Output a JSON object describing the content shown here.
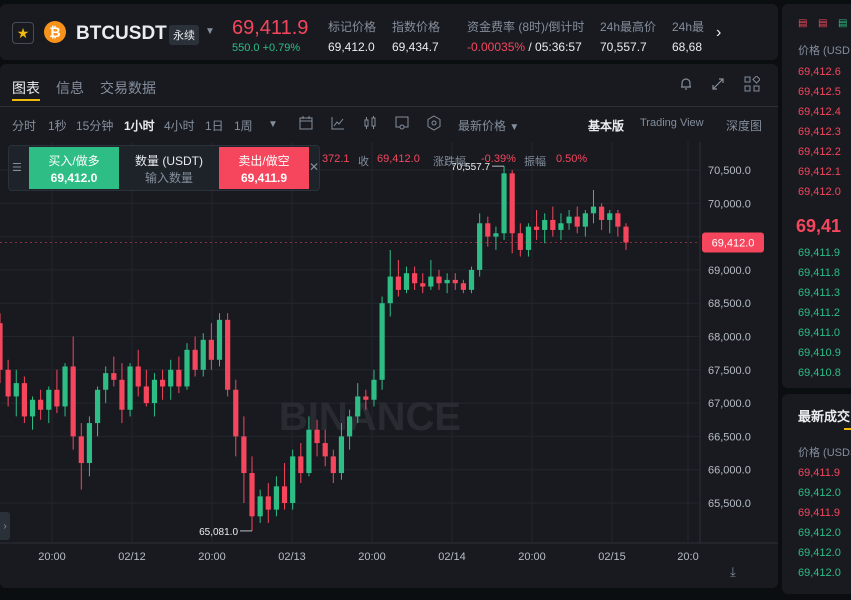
{
  "ticker": {
    "symbol": "BTCUSDT",
    "contract_type": "永续",
    "last_price": "69,411.9",
    "change": "550.0 +0.79%",
    "stats": [
      {
        "label": "标记价格",
        "value": "69,412.0"
      },
      {
        "label": "指数价格",
        "value": "69,434.7"
      },
      {
        "label": "资金费率 (8时)/倒计时",
        "value_rate": "-0.00035%",
        "value_countdown": "/ 05:36:57"
      },
      {
        "label": "24h最高价",
        "value": "70,557.7"
      },
      {
        "label": "24h最",
        "value": "68,68"
      }
    ]
  },
  "tabs": [
    "图表",
    "信息",
    "交易数据"
  ],
  "intervals": [
    "分时",
    "1秒",
    "15分钟",
    "1小时",
    "4小时",
    "1日",
    "1周"
  ],
  "active_interval": "1小时",
  "price_type": "最新价格",
  "views": [
    "基本版",
    "Trading View",
    "深度图"
  ],
  "order_widget": {
    "buy_label": "买入/做多",
    "buy_price": "69,412.0",
    "qty_label": "数量 (USDT)",
    "qty_placeholder": "输入数量",
    "sell_label": "卖出/做空",
    "sell_price": "69,411.9"
  },
  "ohlc": {
    "partial": "372.1",
    "close_label": "收",
    "close": "69,412.0",
    "change_label": "涨跌幅",
    "change": "-0.39%",
    "amp_label": "振幅",
    "amp": "0.50%"
  },
  "chart_data": {
    "type": "candlestick",
    "watermark": "BINANCE",
    "y_ticks": [
      65500,
      66000,
      66500,
      67000,
      67500,
      68000,
      68500,
      69000,
      69500,
      70000,
      70500
    ],
    "x_labels": [
      "20:00",
      "02/12",
      "20:00",
      "02/13",
      "20:00",
      "02/14",
      "20:00",
      "02/15",
      "20:0"
    ],
    "current_price": "69,412.0",
    "high_marker": "70,557.7",
    "low_marker": "65,081.0",
    "candles": [
      [
        68200,
        68350,
        67300,
        67500
      ],
      [
        67500,
        67650,
        66950,
        67100
      ],
      [
        67100,
        67500,
        66800,
        67300
      ],
      [
        67300,
        67400,
        66700,
        66800
      ],
      [
        66800,
        67100,
        66600,
        67050
      ],
      [
        67050,
        67200,
        66750,
        66900
      ],
      [
        66900,
        67250,
        66700,
        67200
      ],
      [
        67200,
        67500,
        66850,
        66950
      ],
      [
        66950,
        67600,
        66800,
        67550
      ],
      [
        67550,
        68000,
        66300,
        66500
      ],
      [
        66500,
        66700,
        65700,
        66100
      ],
      [
        66100,
        66800,
        65900,
        66700
      ],
      [
        66700,
        67250,
        66500,
        67200
      ],
      [
        67200,
        67550,
        67000,
        67450
      ],
      [
        67450,
        67700,
        67250,
        67350
      ],
      [
        67350,
        67600,
        66700,
        66900
      ],
      [
        66900,
        67600,
        66800,
        67550
      ],
      [
        67550,
        67800,
        67100,
        67250
      ],
      [
        67250,
        67500,
        66950,
        67000
      ],
      [
        67000,
        67450,
        66800,
        67350
      ],
      [
        67350,
        67500,
        67050,
        67250
      ],
      [
        67250,
        67650,
        67050,
        67500
      ],
      [
        67500,
        67700,
        67150,
        67250
      ],
      [
        67250,
        67900,
        67200,
        67800
      ],
      [
        67800,
        68000,
        67400,
        67500
      ],
      [
        67500,
        68050,
        67400,
        67950
      ],
      [
        67950,
        68200,
        67500,
        67650
      ],
      [
        67650,
        68350,
        67550,
        68250
      ],
      [
        68250,
        68350,
        67100,
        67200
      ],
      [
        67200,
        67350,
        66200,
        66500
      ],
      [
        66500,
        66800,
        65500,
        65950
      ],
      [
        65950,
        66200,
        65081,
        65300
      ],
      [
        65300,
        65700,
        65200,
        65600
      ],
      [
        65600,
        65800,
        65200,
        65400
      ],
      [
        65400,
        65900,
        65300,
        65750
      ],
      [
        65750,
        66100,
        65400,
        65500
      ],
      [
        65500,
        66300,
        65400,
        66200
      ],
      [
        66200,
        66400,
        65800,
        65950
      ],
      [
        65950,
        66800,
        65900,
        66600
      ],
      [
        66600,
        66750,
        66200,
        66400
      ],
      [
        66400,
        66600,
        66050,
        66200
      ],
      [
        66200,
        66300,
        65800,
        65950
      ],
      [
        65950,
        66700,
        65850,
        66500
      ],
      [
        66500,
        66900,
        66300,
        66800
      ],
      [
        66800,
        67300,
        66700,
        67100
      ],
      [
        67100,
        67200,
        66900,
        67050
      ],
      [
        67050,
        67500,
        66950,
        67350
      ],
      [
        67350,
        68600,
        67200,
        68500
      ],
      [
        68500,
        69300,
        68300,
        68900
      ],
      [
        68900,
        69150,
        68600,
        68700
      ],
      [
        68700,
        69050,
        68650,
        68950
      ],
      [
        68950,
        69050,
        68700,
        68800
      ],
      [
        68800,
        68950,
        68650,
        68750
      ],
      [
        68750,
        69150,
        68700,
        68900
      ],
      [
        68900,
        69000,
        68700,
        68800
      ],
      [
        68800,
        68950,
        68650,
        68850
      ],
      [
        68850,
        68950,
        68700,
        68800
      ],
      [
        68800,
        68850,
        68650,
        68700
      ],
      [
        68700,
        69050,
        68650,
        69000
      ],
      [
        69000,
        69850,
        68900,
        69700
      ],
      [
        69700,
        69800,
        69350,
        69500
      ],
      [
        69500,
        69650,
        69300,
        69550
      ],
      [
        69550,
        70557.7,
        69450,
        70450
      ],
      [
        70450,
        70500,
        69250,
        69550
      ],
      [
        69550,
        69700,
        69200,
        69300
      ],
      [
        69300,
        69700,
        69200,
        69650
      ],
      [
        69650,
        69900,
        69450,
        69600
      ],
      [
        69600,
        69850,
        69400,
        69750
      ],
      [
        69750,
        69950,
        69500,
        69600
      ],
      [
        69600,
        69850,
        69450,
        69700
      ],
      [
        69700,
        69900,
        69600,
        69800
      ],
      [
        69800,
        69950,
        69550,
        69650
      ],
      [
        69650,
        69900,
        69500,
        69850
      ],
      [
        69850,
        70200,
        69700,
        69950
      ],
      [
        69950,
        70000,
        69600,
        69750
      ],
      [
        69750,
        69900,
        69550,
        69850
      ],
      [
        69850,
        69900,
        69500,
        69650
      ],
      [
        69650,
        69700,
        69300,
        69412
      ]
    ]
  },
  "orderbook": {
    "header": "价格 (USD",
    "asks": [
      "69,412.6",
      "69,412.5",
      "69,412.4",
      "69,412.3",
      "69,412.2",
      "69,412.1",
      "69,412.0"
    ],
    "mid": "69,41",
    "bids": [
      "69,411.9",
      "69,411.8",
      "69,411.3",
      "69,411.2",
      "69,411.0",
      "69,410.9",
      "69,410.8"
    ]
  },
  "trades": {
    "title": "最新成交",
    "header": "价格 (USDS",
    "rows": [
      {
        "price": "69,411.9",
        "side": "sell"
      },
      {
        "price": "69,412.0",
        "side": "buy"
      },
      {
        "price": "69,411.9",
        "side": "sell"
      },
      {
        "price": "69,412.0",
        "side": "buy"
      },
      {
        "price": "69,412.0",
        "side": "buy"
      },
      {
        "price": "69,412.0",
        "side": "buy"
      }
    ]
  },
  "colors": {
    "up": "#2ebd85",
    "down": "#f6465d",
    "accent": "#f0b90b",
    "bg": "#181a20"
  }
}
